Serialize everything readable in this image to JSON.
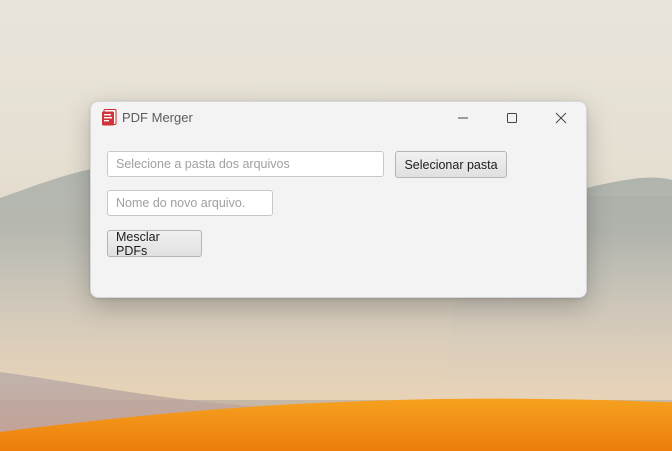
{
  "window": {
    "title": "PDF Merger",
    "app_icon": "pdf-file-icon",
    "controls": {
      "minimize_icon": "minimize-icon",
      "maximize_icon": "maximize-icon",
      "close_icon": "close-icon"
    }
  },
  "form": {
    "folder_input": {
      "value": "",
      "placeholder": "Selecione a pasta dos arquivos"
    },
    "select_folder_button": "Selecionar pasta",
    "filename_input": {
      "value": "",
      "placeholder": "Nome do novo arquivo."
    },
    "merge_button": "Mesclar PDFs"
  },
  "colors": {
    "window_bg": "#f3f3f3",
    "pdf_red": "#d13438",
    "sand_orange": "#f08a12"
  }
}
